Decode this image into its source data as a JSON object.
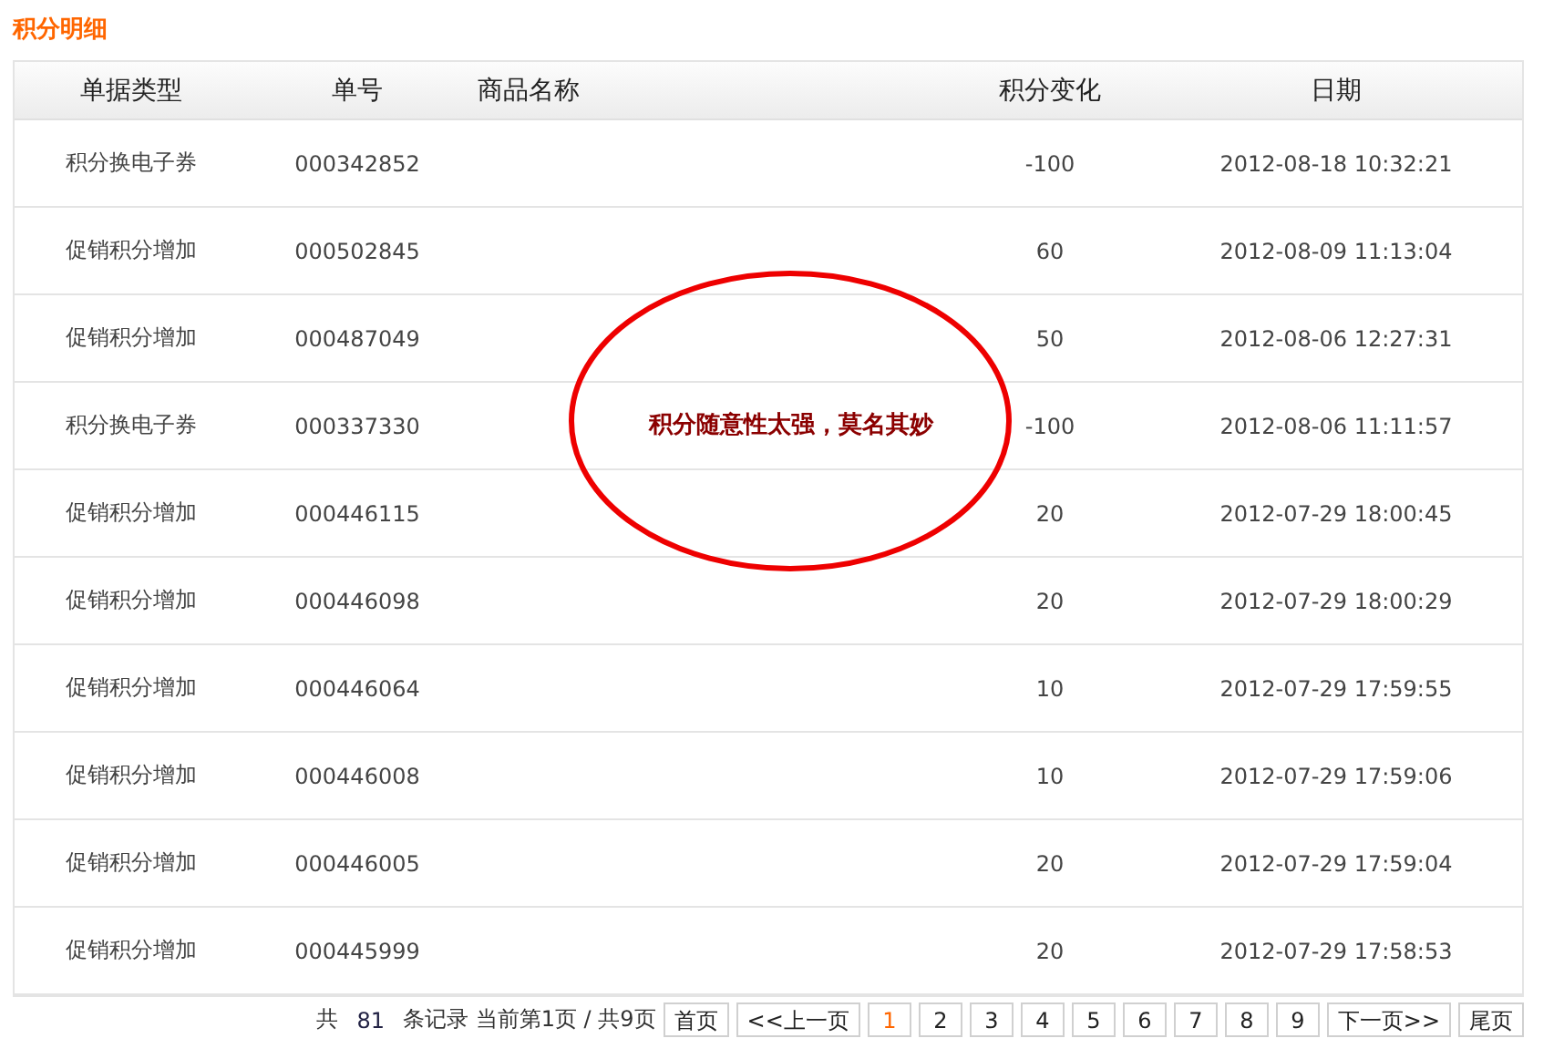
{
  "title": "积分明细",
  "table": {
    "columns": [
      "单据类型",
      "单号",
      "商品名称",
      "积分变化",
      "日期"
    ],
    "rows": [
      {
        "type": "积分换电子券",
        "number": "000342852",
        "name": "",
        "change": "-100",
        "date": "2012-08-18 10:32:21"
      },
      {
        "type": "促销积分增加",
        "number": "000502845",
        "name": "",
        "change": "60",
        "date": "2012-08-09 11:13:04"
      },
      {
        "type": "促销积分增加",
        "number": "000487049",
        "name": "",
        "change": "50",
        "date": "2012-08-06 12:27:31"
      },
      {
        "type": "积分换电子券",
        "number": "000337330",
        "name": "",
        "change": "-100",
        "date": "2012-08-06 11:11:57"
      },
      {
        "type": "促销积分增加",
        "number": "000446115",
        "name": "",
        "change": "20",
        "date": "2012-07-29 18:00:45"
      },
      {
        "type": "促销积分增加",
        "number": "000446098",
        "name": "",
        "change": "20",
        "date": "2012-07-29 18:00:29"
      },
      {
        "type": "促销积分增加",
        "number": "000446064",
        "name": "",
        "change": "10",
        "date": "2012-07-29 17:59:55"
      },
      {
        "type": "促销积分增加",
        "number": "000446008",
        "name": "",
        "change": "10",
        "date": "2012-07-29 17:59:06"
      },
      {
        "type": "促销积分增加",
        "number": "000446005",
        "name": "",
        "change": "20",
        "date": "2012-07-29 17:59:04"
      },
      {
        "type": "促销积分增加",
        "number": "000445999",
        "name": "",
        "change": "20",
        "date": "2012-07-29 17:58:53"
      }
    ]
  },
  "annotation": {
    "text": "积分随意性太强，莫名其妙"
  },
  "pagination": {
    "prefix": "共",
    "total": "81",
    "suffix": "条记录 当前第1页 / 共9页",
    "buttons": [
      {
        "label": "首页",
        "selected": false
      },
      {
        "label": "<<上一页",
        "selected": false
      },
      {
        "label": "1",
        "selected": true
      },
      {
        "label": "2",
        "selected": false
      },
      {
        "label": "3",
        "selected": false
      },
      {
        "label": "4",
        "selected": false
      },
      {
        "label": "5",
        "selected": false
      },
      {
        "label": "6",
        "selected": false
      },
      {
        "label": "7",
        "selected": false
      },
      {
        "label": "8",
        "selected": false
      },
      {
        "label": "9",
        "selected": false
      },
      {
        "label": "下一页>>",
        "selected": false
      },
      {
        "label": "尾页",
        "selected": false
      }
    ]
  }
}
